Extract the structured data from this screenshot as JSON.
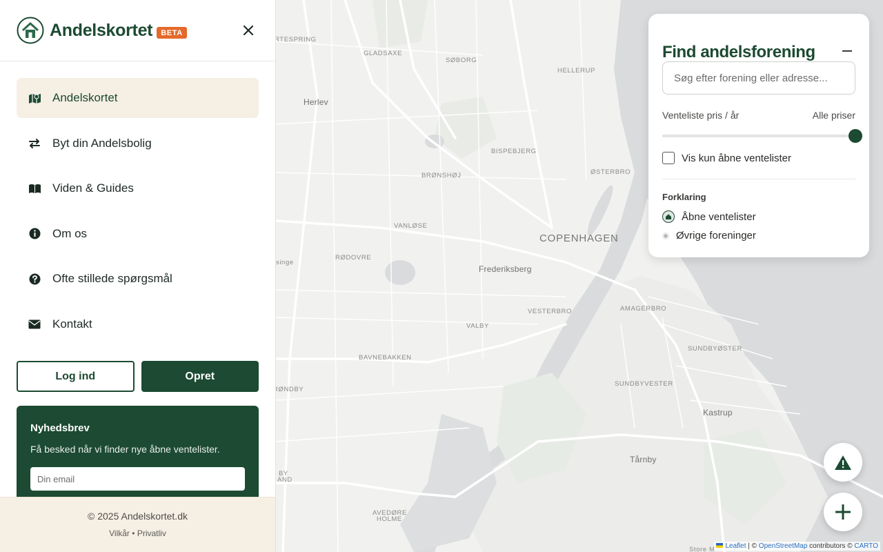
{
  "sidebar": {
    "brand": "Andelskortet",
    "badge": "BETA",
    "nav": [
      {
        "label": "Andelskortet",
        "icon": "map-icon"
      },
      {
        "label": "Byt din Andelsbolig",
        "icon": "swap-arrows-icon"
      },
      {
        "label": "Viden & Guides",
        "icon": "book-icon"
      },
      {
        "label": "Om os",
        "icon": "info-icon"
      },
      {
        "label": "Ofte stillede spørgsmål",
        "icon": "question-icon"
      },
      {
        "label": "Kontakt",
        "icon": "envelope-icon"
      }
    ],
    "login_label": "Log ind",
    "signup_label": "Opret",
    "newsletter": {
      "title": "Nyhedsbrev",
      "text": "Få besked når vi finder nye åbne ventelister.",
      "email_placeholder": "Din email"
    },
    "footer": {
      "copyright": "© 2025 Andelskortet.dk",
      "terms": "Vilkår",
      "separator": "•",
      "privacy": "Privatliv"
    }
  },
  "panel": {
    "title": "Find andelsforening",
    "search_placeholder": "Søg efter forening eller adresse...",
    "price_label": "Venteliste pris / år",
    "price_value": "Alle priser",
    "price_slider_fraction": 1.0,
    "only_open_label": "Vis kun åbne ventelister",
    "only_open_checked": false,
    "legend_title": "Forklaring",
    "legend_open": "Åbne ventelister",
    "legend_other": "Øvrige foreninger"
  },
  "map": {
    "places": [
      {
        "name": "RTESPRING",
        "cls": "small"
      },
      {
        "name": "GLADSAXE",
        "cls": "small"
      },
      {
        "name": "SØBORG",
        "cls": "small"
      },
      {
        "name": "HELLERUP",
        "cls": "small"
      },
      {
        "name": "Herlev",
        "cls": "mid"
      },
      {
        "name": "BISPEBJERG",
        "cls": "small"
      },
      {
        "name": "BRØNSHØJ",
        "cls": "small"
      },
      {
        "name": "ØSTERBRO",
        "cls": "small"
      },
      {
        "name": "COPENHAGEN",
        "cls": "big"
      },
      {
        "name": "VANLØSE",
        "cls": "small"
      },
      {
        "name": "singe",
        "cls": "small"
      },
      {
        "name": "RØDOVRE",
        "cls": "small"
      },
      {
        "name": "Frederiksberg",
        "cls": "mid"
      },
      {
        "name": "VESTERBRO",
        "cls": "small"
      },
      {
        "name": "AMAGERBRO",
        "cls": "small"
      },
      {
        "name": "VALBY",
        "cls": "small"
      },
      {
        "name": "SUNDBYØSTER",
        "cls": "small"
      },
      {
        "name": "BAVNEBAKKEN",
        "cls": "small"
      },
      {
        "name": "SUNDBYVESTER",
        "cls": "small"
      },
      {
        "name": "RØNDBY",
        "cls": "small"
      },
      {
        "name": "Kastrup",
        "cls": "mid"
      },
      {
        "name": "Tårnby",
        "cls": "mid"
      },
      {
        "name": "BY",
        "cls": "small"
      },
      {
        "name": "AND",
        "cls": "small"
      },
      {
        "name": "AVEDØRE",
        "cls": "small"
      },
      {
        "name": "HOLME",
        "cls": "small"
      },
      {
        "name": "Store M",
        "cls": "small"
      }
    ],
    "attribution": {
      "leaflet": "Leaflet",
      "sep1": " | © ",
      "osm": "OpenStreetMap",
      "mid": " contributors © ",
      "carto": "CARTO"
    }
  },
  "fabs": [
    {
      "icon": "warning-icon"
    },
    {
      "icon": "plus-icon"
    }
  ],
  "colors": {
    "brand": "#1c4a32",
    "accent": "#e4692a",
    "active_bg": "#f5efe4"
  }
}
